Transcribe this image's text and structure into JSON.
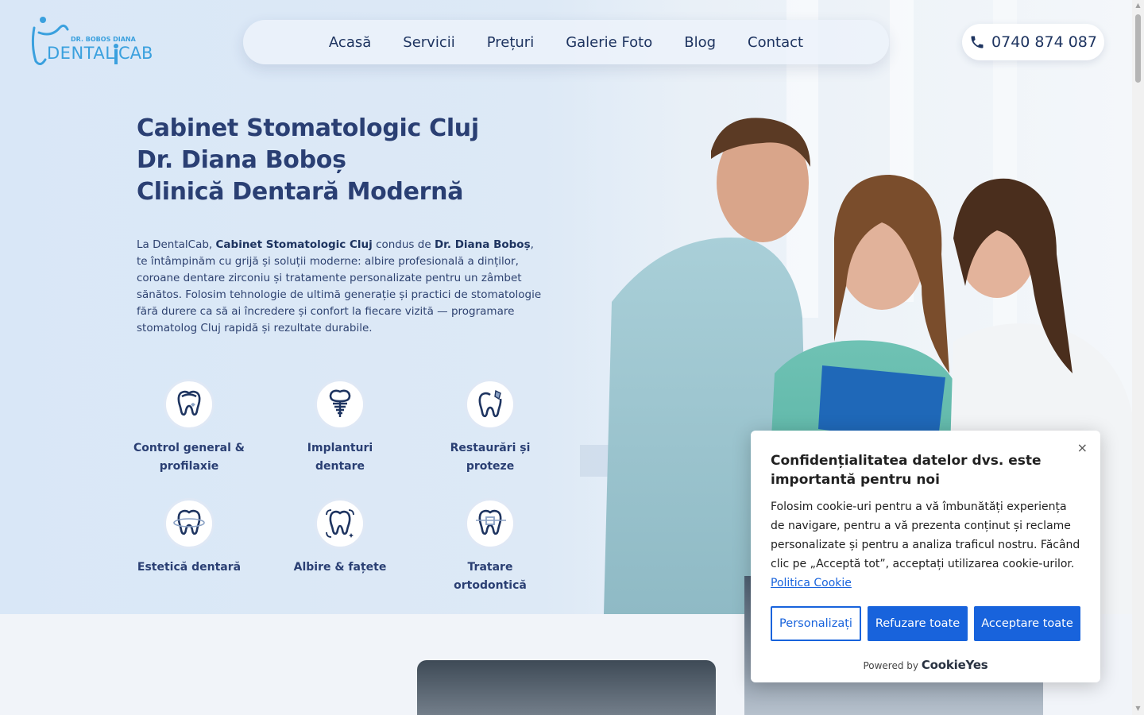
{
  "brand": {
    "name": "DENTALCAB",
    "subtitle": "DR. BOBOS DIANA"
  },
  "nav": {
    "items": [
      "Acasă",
      "Servicii",
      "Prețuri",
      "Galerie Foto",
      "Blog",
      "Contact"
    ]
  },
  "phone": {
    "number": "0740 874 087"
  },
  "hero": {
    "title_lines": [
      "Cabinet Stomatologic Cluj",
      "Dr. Diana Boboș",
      "Clinică Dentară Modernă"
    ],
    "intro": {
      "t1": "La DentalCab, ",
      "b1": "Cabinet Stomatologic Cluj",
      "t2": " condus de ",
      "b2": "Dr. Diana Boboș",
      "t3": ", te întâmpinăm cu grijă și soluții moderne: albire profesională a dinților, coroane dentare zirconiu și tratamente personalizate pentru un zâmbet sănătos. Folosim tehnologie de ultimă generație și practici de stomatologie fără durere ca să ai încredere și confort la fiecare vizită — programare stomatolog Cluj rapidă și rezultate durabile."
    }
  },
  "services": [
    {
      "l1": "Control general &",
      "l2": "profilaxie",
      "icon": "tooth-check-icon"
    },
    {
      "l1": "Implanturi",
      "l2": "dentare",
      "icon": "tooth-implant-icon"
    },
    {
      "l1": "Restaurări și",
      "l2": "proteze",
      "icon": "tooth-restoration-icon"
    },
    {
      "l1": "Estetică dentară",
      "l2": "",
      "icon": "tooth-aesthetic-icon"
    },
    {
      "l1": "Albire & fațete",
      "l2": "",
      "icon": "tooth-whitening-icon"
    },
    {
      "l1": "Tratare",
      "l2": "ortodontică",
      "icon": "tooth-braces-icon"
    }
  ],
  "cookie": {
    "title": "Confidențialitatea datelor dvs. este importantă pentru noi",
    "text": "Folosim cookie-uri pentru a vă îmbunătăți experiența de navigare, pentru a vă prezenta conținut și reclame personalizate și pentru a analiza traficul nostru. Făcând clic pe „Acceptă tot”, acceptați utilizarea cookie-urilor. ",
    "policy_link": "Politica Cookie",
    "customize": "Personalizați",
    "reject": "Refuzare toate",
    "accept": "Acceptare toate",
    "powered_by": "Powered by",
    "powered_brand": "CookieYes",
    "close": "×"
  },
  "colors": {
    "primary": "#2a3f73",
    "accent": "#1863dc",
    "logo_blue": "#3aa0de"
  }
}
